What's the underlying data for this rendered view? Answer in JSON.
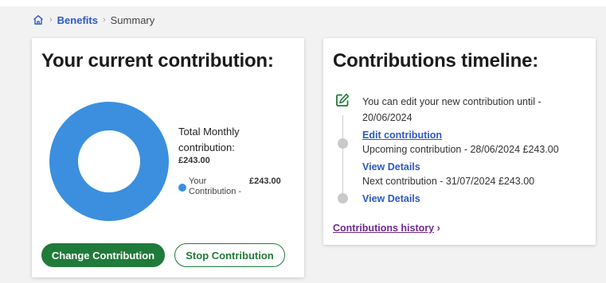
{
  "breadcrumb": {
    "home_icon": "home-icon",
    "items": [
      "Benefits",
      "Summary"
    ]
  },
  "current_contribution": {
    "title": "Your current contribution:",
    "total_label": "Total Monthly contribution:",
    "total_value": "£243.00",
    "legend": {
      "name": "Your Contribution -",
      "value": "£243.00",
      "color": "#3b8fde"
    },
    "donut": {
      "share": 1.0
    },
    "buttons": {
      "change": "Change Contribution",
      "stop": "Stop Contribution"
    }
  },
  "timeline": {
    "title": "Contributions timeline:",
    "edit_text": "You can edit your new contribution until - 20/06/2024",
    "edit_link": "Edit contribution",
    "upcoming_text": "Upcoming contribution - 28/06/2024 £243.00",
    "view_details_1": "View Details",
    "next_text": "Next contribution - 31/07/2024 £243.00",
    "view_details_2": "View Details",
    "history_link": "Contributions history",
    "history_chevron": "›"
  },
  "colors": {
    "primary_green": "#207a3a",
    "link_blue": "#2b59c3",
    "history_purple": "#6d2a8a",
    "donut_blue": "#3b8fde"
  }
}
